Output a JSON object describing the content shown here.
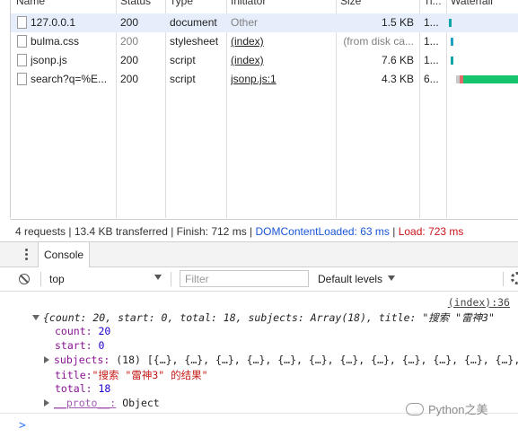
{
  "network": {
    "columns": [
      "Name",
      "Status",
      "Type",
      "Initiator",
      "Size",
      "Ti...",
      "Waterfall"
    ],
    "rows": [
      {
        "name": "127.0.0.1",
        "status": "200",
        "type": "document",
        "initiator": "Other",
        "size": "1.5 KB",
        "time": "1...",
        "selected": true
      },
      {
        "name": "bulma.css",
        "status": "200",
        "type": "stylesheet",
        "initiator": "(index)",
        "size": "(from disk ca...",
        "time": "1..."
      },
      {
        "name": "jsonp.js",
        "status": "200",
        "type": "script",
        "initiator": "(index)",
        "size": "7.6 KB",
        "time": "1..."
      },
      {
        "name": "search?q=%E...",
        "status": "200",
        "type": "script",
        "initiator": "jsonp.js:1",
        "size": "4.3 KB",
        "time": "6..."
      }
    ]
  },
  "summary": {
    "requests": "4 requests | 13.4 KB transferred | Finish: 712 ms | ",
    "dom": "DOMContentLoaded: 63 ms",
    "sep": " | ",
    "load": "Load: 723 ms"
  },
  "drawer": {
    "tab": "Console"
  },
  "toolbar": {
    "context": "top",
    "filter_placeholder": "Filter",
    "levels": "Default levels"
  },
  "console": {
    "source": "(index):36",
    "object_head": "{count: 20, start: 0, total: 18, subjects: Array(18), title: \"搜索 \"雷神3\"",
    "p_count_k": "count:",
    "p_count_v": "20",
    "p_start_k": "start:",
    "p_start_v": "0",
    "p_subjects_k": "subjects:",
    "p_subjects_v": "(18) [{…}, {…}, {…}, {…}, {…}, {…}, {…}, {…}, {…}, {…}, {…}, {…}, {",
    "p_title_k": "title:",
    "p_title_v": "\"搜索 \"雷神3\" 的结果\"",
    "p_total_k": "total:",
    "p_total_v": "18",
    "p_proto_k": "__proto__:",
    "p_proto_v": "Object"
  },
  "prompt": ">",
  "watermark": "Python之美",
  "colors": {
    "blue": "#1a56d6",
    "red": "#c8151b",
    "select_bg": "#e6eefc",
    "waterfall_green": "#16c46d",
    "waterfall_teal": "#0aa3a6"
  }
}
